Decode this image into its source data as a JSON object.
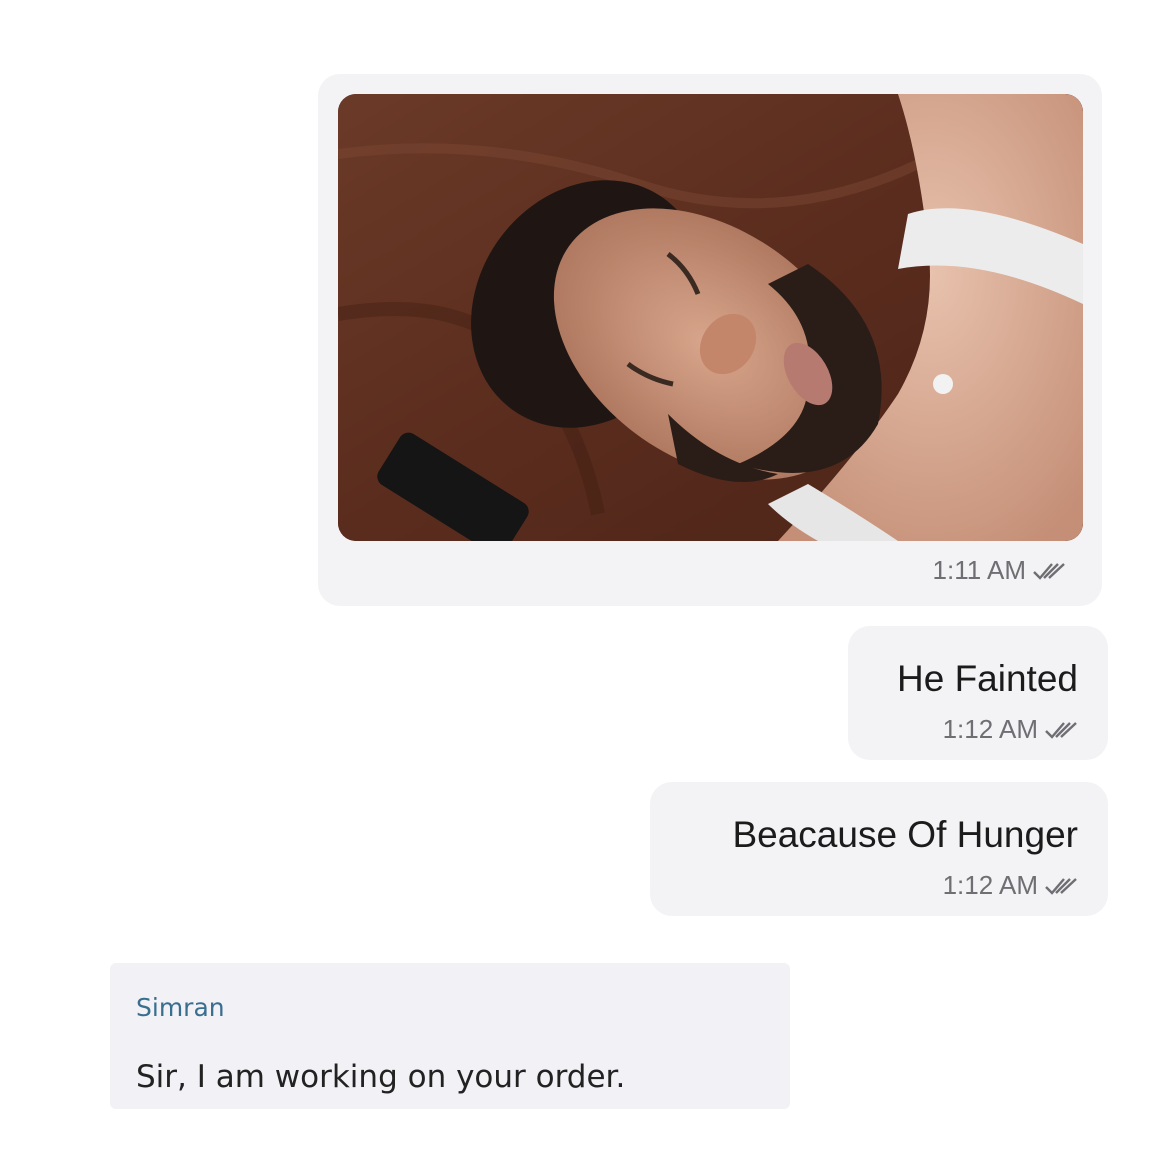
{
  "messages": {
    "photo": {
      "time": "1:11 AM",
      "status_icon": "double-check-icon"
    },
    "fainted": {
      "text": "He Fainted",
      "time": "1:12 AM",
      "status_icon": "double-check-icon"
    },
    "hunger": {
      "text": "Beacause Of Hunger",
      "time": "1:12 AM",
      "status_icon": "double-check-icon"
    },
    "reply": {
      "sender": "Simran",
      "text": "Sir, I am working on your order."
    }
  },
  "colors": {
    "outgoing_bubble": "#f3f3f6",
    "incoming_bubble": "#f1f1f6",
    "sender_name": "#3a6e8f",
    "timestamp": "#6e6e73",
    "message_text": "#1b1b1b"
  }
}
